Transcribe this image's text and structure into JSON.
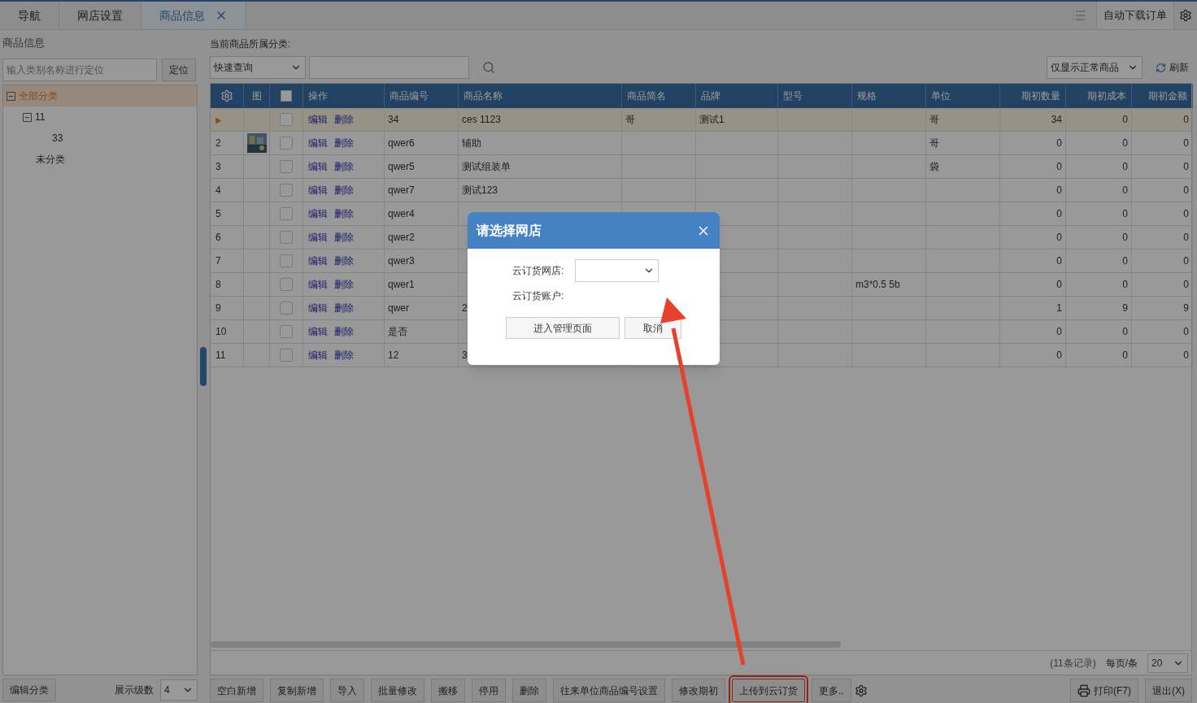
{
  "tabs": [
    {
      "label": "导航",
      "selected": false,
      "closable": false
    },
    {
      "label": "网店设置",
      "selected": false,
      "closable": false
    },
    {
      "label": "商品信息",
      "selected": true,
      "closable": true
    }
  ],
  "top_actions": {
    "auto_download": "自动下载订单"
  },
  "sidebar": {
    "title": "商品信息",
    "search": {
      "placeholder": "输入类别名称进行定位"
    },
    "locate_button": "定位",
    "tree": [
      {
        "label": "全部分类",
        "selected": true,
        "expanded": true,
        "children": [
          {
            "label": "11",
            "selected": false,
            "expanded": true,
            "children": [
              {
                "label": "33",
                "selected": false
              }
            ]
          },
          {
            "label": "未分类",
            "selected": false
          }
        ]
      }
    ],
    "edit_button": "编辑分类",
    "levels_label": "展示级数",
    "levels_value": "4"
  },
  "filter": {
    "category_label": "当前商品所属分类:",
    "query_select": "快速查询",
    "status_select": "仅显示正常商品",
    "refresh": "刷新"
  },
  "table": {
    "header_checked": false,
    "image_column": "图",
    "actions_column": "操作",
    "current_row_marker": "▶",
    "columns": [
      "商品编号",
      "商品名称",
      "商品简名",
      "品牌",
      "型号",
      "规格",
      "单位",
      "期初数量",
      "期初成本",
      "期初金额"
    ],
    "rows": [
      {
        "selected": true,
        "has_image": false,
        "checked": false,
        "actions": [
          "编辑",
          "删除"
        ],
        "cells": {
          "code": "34",
          "name": "ces 1123",
          "short_name": "哥",
          "brand": "测试1",
          "unit": "哥",
          "qty": "34",
          "cost": "0",
          "amount": "0"
        }
      },
      {
        "row_number": "2",
        "selected": false,
        "has_image": true,
        "checked": false,
        "actions": [
          "编辑",
          "删除"
        ],
        "cells": {
          "code": "qwer6",
          "name": "辅助",
          "unit": "哥",
          "qty": "0",
          "cost": "0",
          "amount": "0"
        }
      },
      {
        "row_number": "3",
        "selected": false,
        "has_image": false,
        "checked": false,
        "actions": [
          "编辑",
          "删除"
        ],
        "cells": {
          "code": "qwer5",
          "name": "测试组装单",
          "unit": "袋",
          "qty": "0",
          "cost": "0",
          "amount": "0"
        }
      },
      {
        "row_number": "4",
        "selected": false,
        "has_image": false,
        "checked": false,
        "actions": [
          "编辑",
          "删除"
        ],
        "cells": {
          "code": "qwer7",
          "name": "测试123",
          "qty": "0",
          "cost": "0",
          "amount": "0"
        }
      },
      {
        "row_number": "5",
        "selected": false,
        "has_image": false,
        "checked": false,
        "actions": [
          "编辑",
          "删除"
        ],
        "cells": {
          "code": "qwer4",
          "qty": "0",
          "cost": "0",
          "amount": "0"
        }
      },
      {
        "row_number": "6",
        "selected": false,
        "has_image": false,
        "checked": false,
        "actions": [
          "编辑",
          "删除"
        ],
        "cells": {
          "code": "qwer2",
          "qty": "0",
          "cost": "0",
          "amount": "0"
        }
      },
      {
        "row_number": "7",
        "selected": false,
        "has_image": false,
        "checked": false,
        "actions": [
          "编辑",
          "删除"
        ],
        "cells": {
          "code": "qwer3",
          "qty": "0",
          "cost": "0",
          "amount": "0"
        }
      },
      {
        "row_number": "8",
        "selected": false,
        "has_image": false,
        "checked": false,
        "actions": [
          "编辑",
          "删除"
        ],
        "cells": {
          "code": "qwer1",
          "spec": "m3*0.5 5b",
          "qty": "0",
          "cost": "0",
          "amount": "0"
        }
      },
      {
        "row_number": "9",
        "selected": false,
        "has_image": false,
        "checked": false,
        "actions": [
          "编辑",
          "删除"
        ],
        "cells": {
          "code": "qwer",
          "name": "2",
          "qty": "1",
          "cost": "9",
          "amount": "9"
        }
      },
      {
        "row_number": "10",
        "selected": false,
        "has_image": false,
        "checked": false,
        "actions": [
          "编辑",
          "删除"
        ],
        "cells": {
          "code": "是否",
          "qty": "0",
          "cost": "0",
          "amount": "0"
        }
      },
      {
        "row_number": "11",
        "selected": false,
        "has_image": false,
        "checked": false,
        "actions": [
          "编辑",
          "删除"
        ],
        "cells": {
          "code": "12",
          "name": "3",
          "qty": "0",
          "cost": "0",
          "amount": "0"
        }
      }
    ],
    "record_count": "(11条记录)",
    "page_size_label": "每页/条",
    "page_size": "20"
  },
  "bottom_buttons": [
    {
      "label": "空白新增",
      "highlighted": false
    },
    {
      "label": "复制新增",
      "highlighted": false
    },
    {
      "label": "导入",
      "highlighted": false
    },
    {
      "label": "批量修改",
      "highlighted": false
    },
    {
      "label": "搬移",
      "highlighted": false
    },
    {
      "label": "停用",
      "highlighted": false
    },
    {
      "label": "删除",
      "highlighted": false
    },
    {
      "label": "往来单位商品编号设置",
      "highlighted": false
    },
    {
      "label": "修改期初",
      "highlighted": false
    },
    {
      "label": "上传到云订货",
      "highlighted": true
    },
    {
      "label": "更多..",
      "highlighted": false
    }
  ],
  "print_button": "打印(F7)",
  "exit_button": "退出(X)",
  "dialog": {
    "title": "请选择网店",
    "fields": [
      {
        "kind": "select",
        "label": "云订货网店:"
      },
      {
        "kind": "text",
        "label": "云订货账户:"
      }
    ],
    "buttons": [
      "进入管理页面",
      "取消"
    ]
  }
}
